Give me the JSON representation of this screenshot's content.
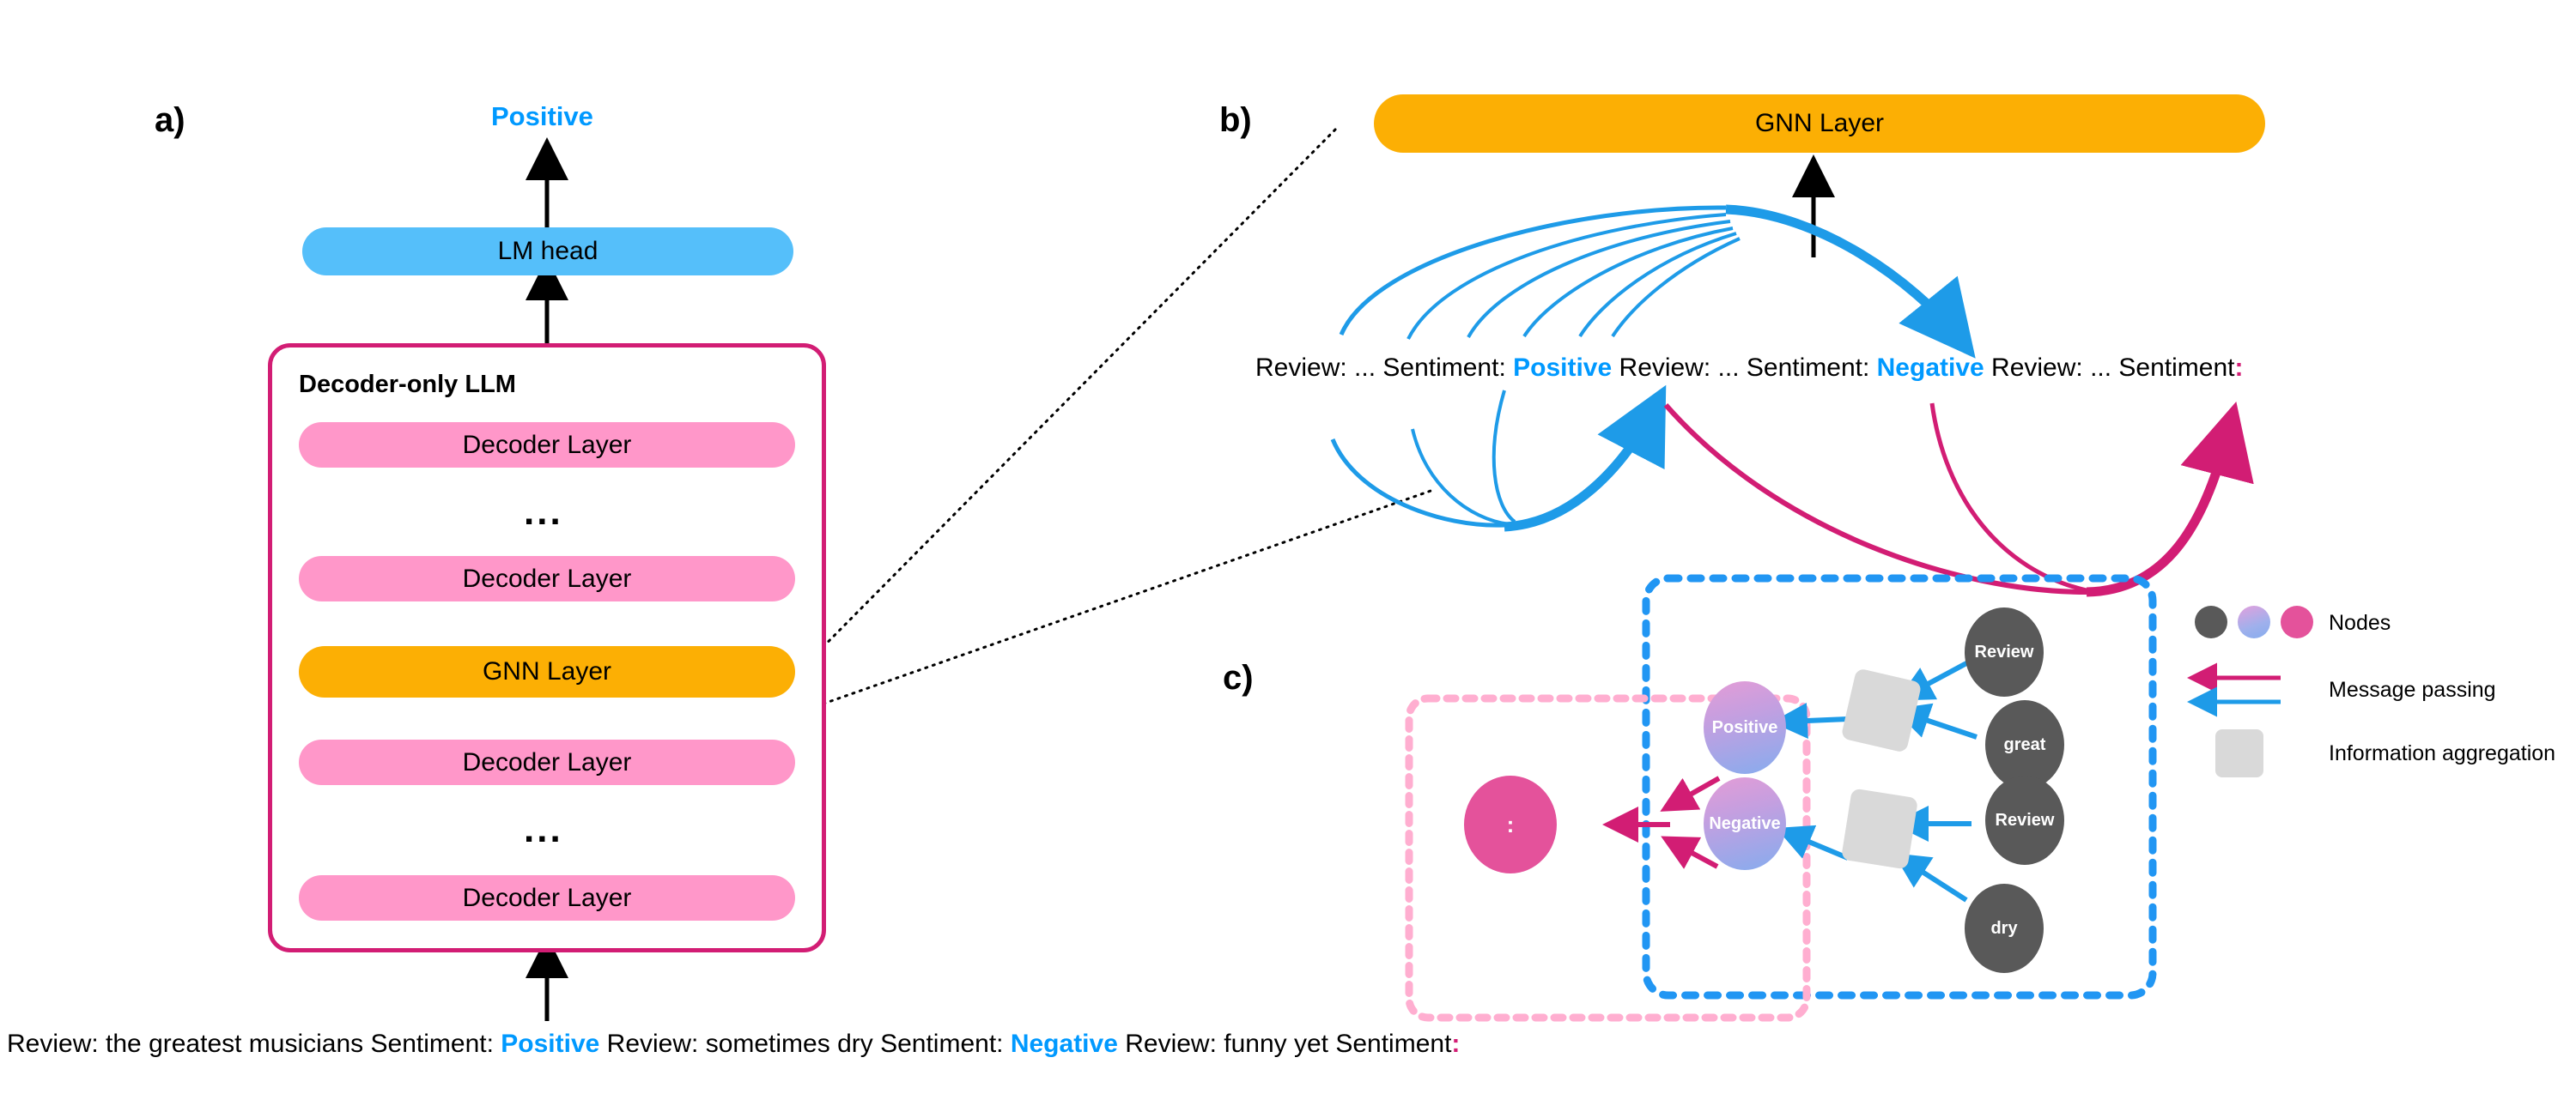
{
  "figure": {
    "panels": [
      {
        "id": "a",
        "label": "a)"
      },
      {
        "id": "b",
        "label": "b)"
      },
      {
        "id": "c",
        "label": "c)"
      }
    ]
  },
  "panel_a": {
    "output_label": "Positive",
    "lm_head_label": "LM head",
    "llm_box_title": "Decoder-only LLM",
    "stack": [
      {
        "type": "decoder",
        "label": "Decoder Layer"
      },
      {
        "type": "ellipsis",
        "label": "..."
      },
      {
        "type": "decoder",
        "label": "Decoder Layer"
      },
      {
        "type": "gnn",
        "label": "GNN Layer"
      },
      {
        "type": "decoder",
        "label": "Decoder Layer"
      },
      {
        "type": "ellipsis",
        "label": "..."
      },
      {
        "type": "decoder",
        "label": "Decoder Layer"
      }
    ],
    "input_sequence": {
      "segments": [
        {
          "text": "Review: the greatest musicians Sentiment: ",
          "style": "plain"
        },
        {
          "text": "Positive",
          "style": "positive"
        },
        {
          "text": " Review: sometimes dry Sentiment: ",
          "style": "plain"
        },
        {
          "text": "Negative",
          "style": "negative"
        },
        {
          "text": " Review: funny yet Sentiment",
          "style": "plain"
        },
        {
          "text": ":",
          "style": "magenta"
        }
      ]
    }
  },
  "panel_b": {
    "gnn_layer_label": "GNN Layer",
    "sequence": {
      "segments": [
        {
          "text": "Review: ... Sentiment: ",
          "style": "plain"
        },
        {
          "text": "Positive",
          "style": "positive"
        },
        {
          "text": " Review: ... Sentiment: ",
          "style": "plain"
        },
        {
          "text": "Negative",
          "style": "negative"
        },
        {
          "text": " Review: ... Sentiment",
          "style": "plain"
        },
        {
          "text": ":",
          "style": "magenta"
        }
      ]
    }
  },
  "panel_c": {
    "nodes": [
      {
        "id": "review-1",
        "label": "Review",
        "kind": "gray"
      },
      {
        "id": "great",
        "label": "great",
        "kind": "gray"
      },
      {
        "id": "review-2",
        "label": "Review",
        "kind": "gray"
      },
      {
        "id": "dry",
        "label": "dry",
        "kind": "gray"
      },
      {
        "id": "positive",
        "label": "Positive",
        "kind": "gradient"
      },
      {
        "id": "negative",
        "label": "Negative",
        "kind": "gradient"
      },
      {
        "id": "target-colon",
        "label": ":",
        "kind": "magenta"
      }
    ],
    "aggregation_boxes": 3
  },
  "legend": {
    "items": [
      {
        "id": "nodes",
        "label": "Nodes",
        "icon": "three-circles"
      },
      {
        "id": "message-passing",
        "label": "Message passing",
        "icon": "two-arrows"
      },
      {
        "id": "information-aggregation",
        "label": "Information aggregation",
        "icon": "gray-square"
      }
    ]
  },
  "colors": {
    "accent_blue": "#0099FF",
    "lm_head_blue": "#55BFFA",
    "decoder_pink": "#FF97C9",
    "gnn_orange": "#FCAF04",
    "magenta": "#D21D74",
    "node_gray": "#595959",
    "node_magenta": "#E4529B",
    "agg_gray": "#D9D9D9",
    "dashed_blue": "#2196F3",
    "dashed_pink": "#FFAEd0"
  }
}
